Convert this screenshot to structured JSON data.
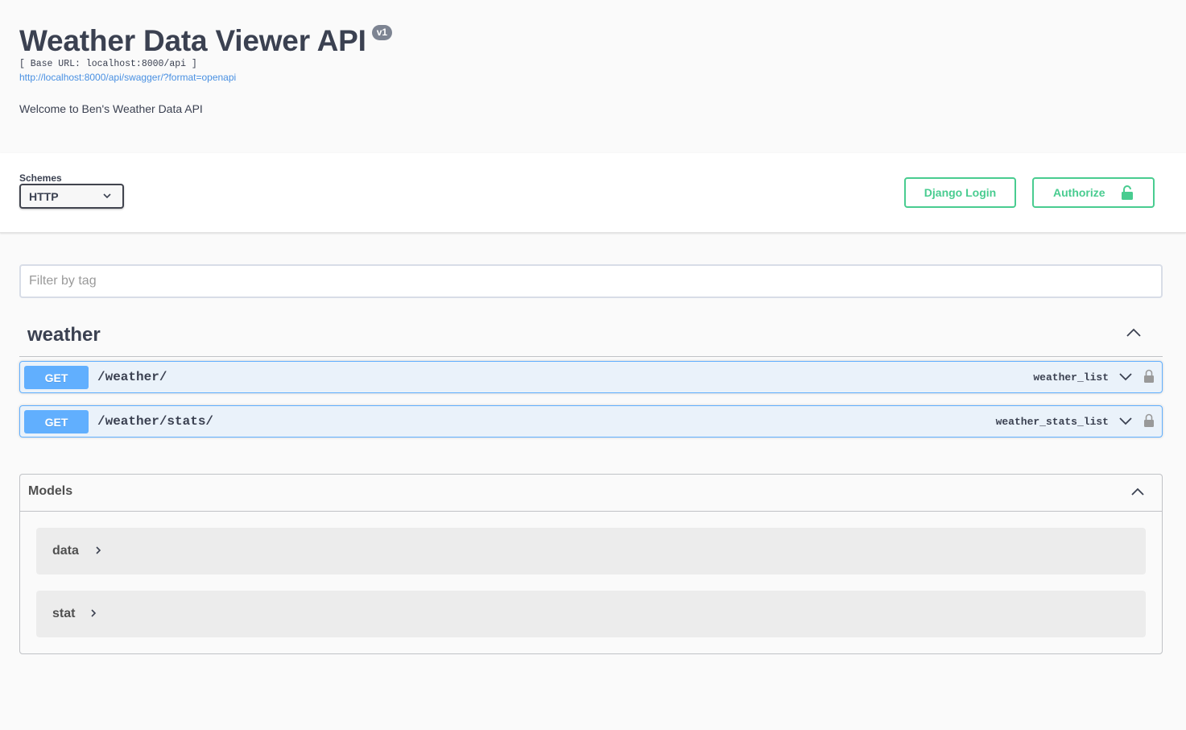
{
  "info": {
    "title": "Weather Data Viewer API",
    "version": "v1",
    "base_url": "[ Base URL: localhost:8000/api ]",
    "spec_link": "http://localhost:8000/api/swagger/?format=openapi",
    "description": "Welcome to Ben's Weather Data API"
  },
  "schemes": {
    "label": "Schemes",
    "selected": "HTTP"
  },
  "buttons": {
    "django_login": "Django Login",
    "authorize": "Authorize"
  },
  "filter": {
    "placeholder": "Filter by tag"
  },
  "tag": {
    "name": "weather",
    "operations": [
      {
        "method": "GET",
        "path": "/weather/",
        "operation_id": "weather_list"
      },
      {
        "method": "GET",
        "path": "/weather/stats/",
        "operation_id": "weather_stats_list"
      }
    ]
  },
  "models": {
    "title": "Models",
    "items": [
      {
        "name": "data"
      },
      {
        "name": "stat"
      }
    ]
  },
  "colors": {
    "get": "#61affe",
    "authorize": "#49cc90",
    "text": "#3b4151",
    "link": "#4990e2"
  }
}
